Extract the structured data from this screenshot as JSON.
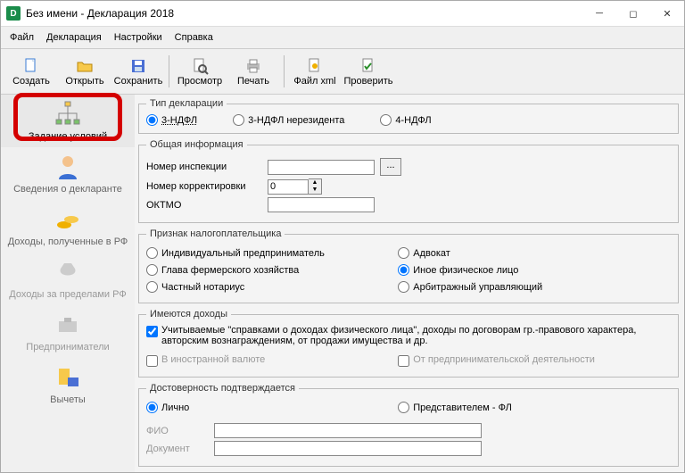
{
  "window": {
    "title": "Без имени - Декларация 2018"
  },
  "menu": {
    "file": "Файл",
    "decl": "Декларация",
    "settings": "Настройки",
    "help": "Справка"
  },
  "toolbar": {
    "create": "Создать",
    "open": "Открыть",
    "save": "Сохранить",
    "view": "Просмотр",
    "print": "Печать",
    "xml": "Файл xml",
    "check": "Проверить"
  },
  "sidebar": {
    "items": [
      {
        "label": "Задание условий"
      },
      {
        "label": "Сведения о декларанте"
      },
      {
        "label": "Доходы, полученные в РФ"
      },
      {
        "label": "Доходы за пределами РФ"
      },
      {
        "label": "Предприниматели"
      },
      {
        "label": "Вычеты"
      }
    ]
  },
  "decl_type": {
    "legend": "Тип декларации",
    "o1": "3-НДФЛ",
    "o2": "3-НДФЛ нерезидента",
    "o3": "4-НДФЛ"
  },
  "general": {
    "legend": "Общая информация",
    "insp": "Номер инспекции",
    "dots": "...",
    "corr": "Номер корректировки",
    "corr_val": "0",
    "oktmo": "ОКТМО"
  },
  "payer": {
    "legend": "Признак налогоплательщика",
    "o1": "Индивидуальный предприниматель",
    "o2": "Адвокат",
    "o3": "Глава фермерского хозяйства",
    "o4": "Иное физическое лицо",
    "o5": "Частный нотариус",
    "o6": "Арбитражный управляющий"
  },
  "income": {
    "legend": "Имеются доходы",
    "c1": "Учитываемые \"справками о доходах физического лица\", доходы по договорам гр.-правового характера, авторским вознаграждениям, от продажи имущества и др.",
    "c2": "В иностранной валюте",
    "c3": "От предпринимательской деятельности"
  },
  "trust": {
    "legend": "Достоверность подтверждается",
    "o1": "Лично",
    "o2": "Представителем - ФЛ",
    "fio": "ФИО",
    "doc": "Документ"
  }
}
